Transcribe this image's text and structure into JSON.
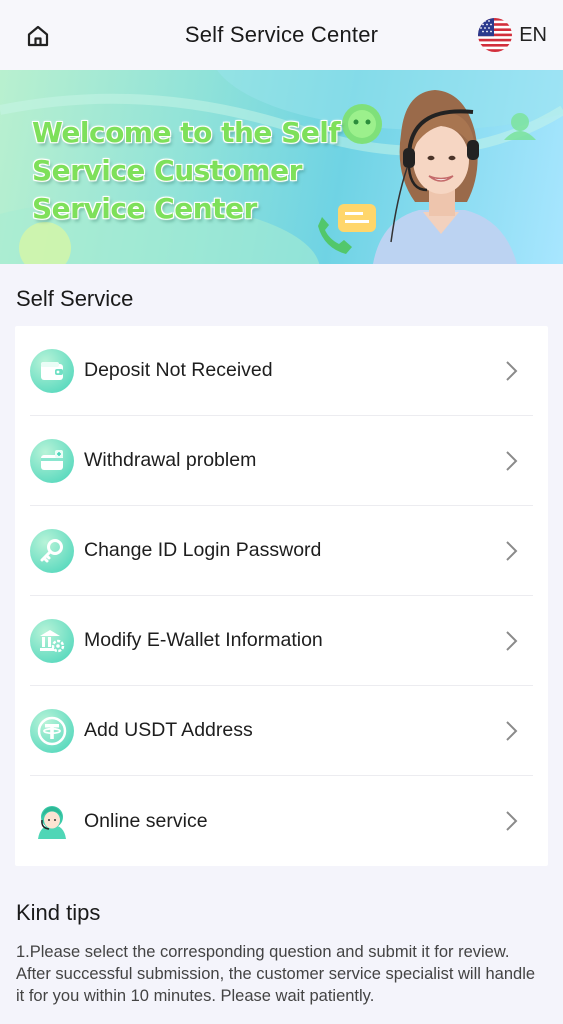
{
  "header": {
    "title": "Self Service Center",
    "lang_code": "EN",
    "home_icon": "home-icon",
    "flag_icon": "us-flag-icon"
  },
  "banner": {
    "line1": "Welcome to the Self",
    "line2": "Service Customer",
    "line3": "Service Center"
  },
  "self_service": {
    "title": "Self Service",
    "items": [
      {
        "label": "Deposit Not Received",
        "icon": "wallet-icon"
      },
      {
        "label": "Withdrawal problem",
        "icon": "card-icon"
      },
      {
        "label": "Change ID Login Password",
        "icon": "key-icon"
      },
      {
        "label": "Modify E-Wallet Information",
        "icon": "bank-gear-icon"
      },
      {
        "label": "Add USDT Address",
        "icon": "tether-icon"
      },
      {
        "label": "Online service",
        "icon": "agent-icon"
      }
    ]
  },
  "tips": {
    "title": "Kind tips",
    "text": "1.Please select the corresponding question and submit it for review. After successful submission, the customer service specialist will handle it for you within 10 minutes. Please wait patiently."
  },
  "colors": {
    "accent": "#3fd3c0",
    "banner_text": "#7ee05a"
  }
}
